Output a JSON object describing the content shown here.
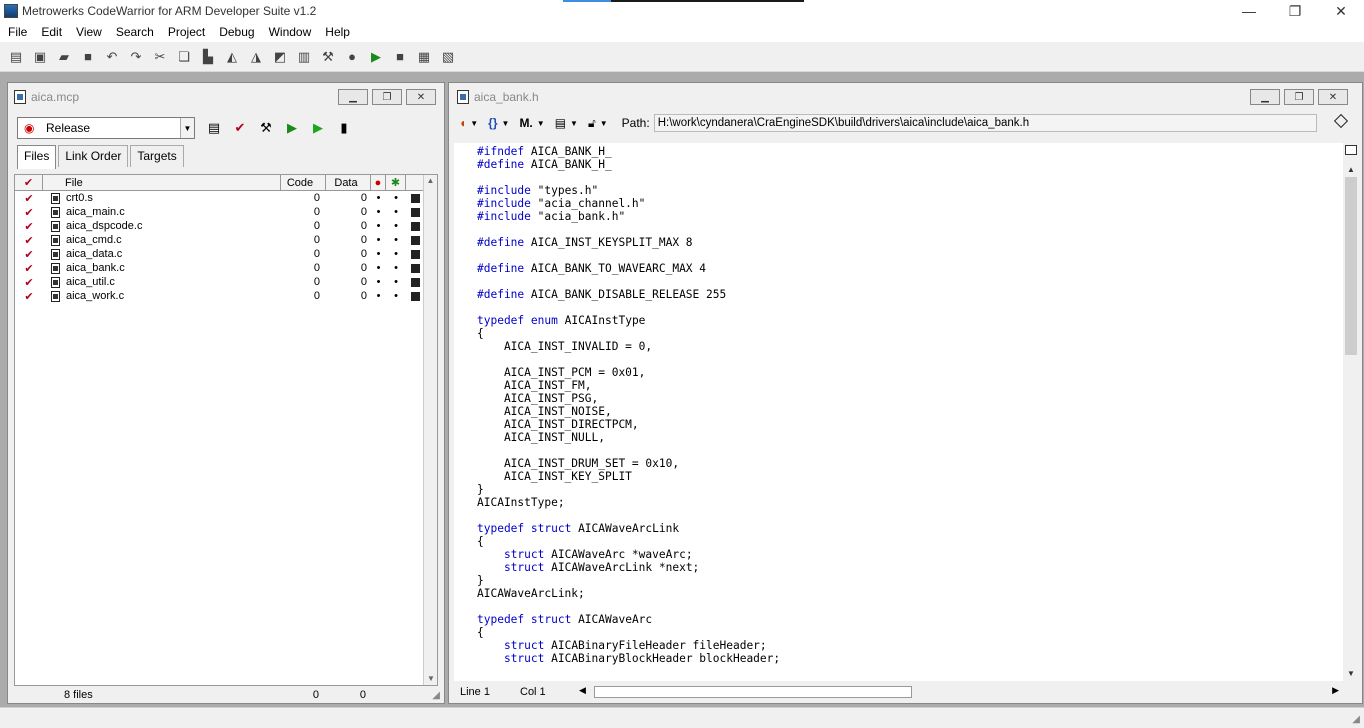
{
  "window": {
    "title": "Metrowerks CodeWarrior for ARM Developer Suite v1.2"
  },
  "menu": [
    "File",
    "Edit",
    "View",
    "Search",
    "Project",
    "Debug",
    "Window",
    "Help"
  ],
  "project": {
    "title": "aica.mcp",
    "target": "Release",
    "tabs": [
      "Files",
      "Link Order",
      "Targets"
    ],
    "columns": {
      "file": "File",
      "code": "Code",
      "data": "Data"
    },
    "files": [
      {
        "name": "crt0.s",
        "code": "0",
        "data": "0"
      },
      {
        "name": "aica_main.c",
        "code": "0",
        "data": "0"
      },
      {
        "name": "aica_dspcode.c",
        "code": "0",
        "data": "0"
      },
      {
        "name": "aica_cmd.c",
        "code": "0",
        "data": "0"
      },
      {
        "name": "aica_data.c",
        "code": "0",
        "data": "0"
      },
      {
        "name": "aica_bank.c",
        "code": "0",
        "data": "0"
      },
      {
        "name": "aica_util.c",
        "code": "0",
        "data": "0"
      },
      {
        "name": "aica_work.c",
        "code": "0",
        "data": "0"
      }
    ],
    "footer": {
      "count": "8 files",
      "code": "0",
      "data": "0"
    }
  },
  "editor": {
    "title": "aica_bank.h",
    "path_label": "Path:",
    "path": "H:\\work\\cyndanera\\CraEngineSDK\\build\\drivers\\aica\\include\\aica_bank.h",
    "status": {
      "line": "Line 1",
      "col": "Col 1"
    },
    "code": [
      [
        [
          "kw",
          "#ifndef"
        ],
        [
          "t",
          " AICA_BANK_H_"
        ]
      ],
      [
        [
          "kw",
          "#define"
        ],
        [
          "t",
          " AICA_BANK_H_"
        ]
      ],
      [],
      [
        [
          "kw",
          "#include"
        ],
        [
          "t",
          " \"types.h\""
        ]
      ],
      [
        [
          "kw",
          "#include"
        ],
        [
          "t",
          " \"acia_channel.h\""
        ]
      ],
      [
        [
          "kw",
          "#include"
        ],
        [
          "t",
          " \"acia_bank.h\""
        ]
      ],
      [],
      [
        [
          "kw",
          "#define"
        ],
        [
          "t",
          " AICA_INST_KEYSPLIT_MAX 8"
        ]
      ],
      [],
      [
        [
          "kw",
          "#define"
        ],
        [
          "t",
          " AICA_BANK_TO_WAVEARC_MAX 4"
        ]
      ],
      [],
      [
        [
          "kw",
          "#define"
        ],
        [
          "t",
          " AICA_BANK_DISABLE_RELEASE 255"
        ]
      ],
      [],
      [
        [
          "kw",
          "typedef"
        ],
        [
          "t",
          " "
        ],
        [
          "kw",
          "enum"
        ],
        [
          "t",
          " AICAInstType"
        ]
      ],
      [
        [
          "t",
          "{"
        ]
      ],
      [
        [
          "t",
          "    AICA_INST_INVALID = 0,"
        ]
      ],
      [],
      [
        [
          "t",
          "    AICA_INST_PCM = 0x01,"
        ]
      ],
      [
        [
          "t",
          "    AICA_INST_FM,"
        ]
      ],
      [
        [
          "t",
          "    AICA_INST_PSG,"
        ]
      ],
      [
        [
          "t",
          "    AICA_INST_NOISE,"
        ]
      ],
      [
        [
          "t",
          "    AICA_INST_DIRECTPCM,"
        ]
      ],
      [
        [
          "t",
          "    AICA_INST_NULL,"
        ]
      ],
      [],
      [
        [
          "t",
          "    AICA_INST_DRUM_SET = 0x10,"
        ]
      ],
      [
        [
          "t",
          "    AICA_INST_KEY_SPLIT"
        ]
      ],
      [
        [
          "t",
          "}"
        ]
      ],
      [
        [
          "t",
          "AICAInstType;"
        ]
      ],
      [],
      [
        [
          "kw",
          "typedef"
        ],
        [
          "t",
          " "
        ],
        [
          "kw",
          "struct"
        ],
        [
          "t",
          " AICAWaveArcLink"
        ]
      ],
      [
        [
          "t",
          "{"
        ]
      ],
      [
        [
          "t",
          "    "
        ],
        [
          "kw",
          "struct"
        ],
        [
          "t",
          " AICAWaveArc *waveArc;"
        ]
      ],
      [
        [
          "t",
          "    "
        ],
        [
          "kw",
          "struct"
        ],
        [
          "t",
          " AICAWaveArcLink *next;"
        ]
      ],
      [
        [
          "t",
          "}"
        ]
      ],
      [
        [
          "t",
          "AICAWaveArcLink;"
        ]
      ],
      [],
      [
        [
          "kw",
          "typedef"
        ],
        [
          "t",
          " "
        ],
        [
          "kw",
          "struct"
        ],
        [
          "t",
          " AICAWaveArc"
        ]
      ],
      [
        [
          "t",
          "{"
        ]
      ],
      [
        [
          "t",
          "    "
        ],
        [
          "kw",
          "struct"
        ],
        [
          "t",
          " AICABinaryFileHeader fileHeader;"
        ]
      ],
      [
        [
          "t",
          "    "
        ],
        [
          "kw",
          "struct"
        ],
        [
          "t",
          " AICABinaryBlockHeader blockHeader;"
        ]
      ]
    ]
  },
  "icons": {
    "toolbar": [
      "new-project-icon",
      "new-file-icon",
      "open-icon",
      "save-icon",
      "undo-icon",
      "redo-icon",
      "cut-icon",
      "copy-icon",
      "paste-icon",
      "find-icon",
      "find-next-icon",
      "replace-icon",
      "compare-icon",
      "make-icon",
      "stop-icon",
      "debug-icon",
      "run-icon",
      "sync-icon",
      "project-settings-icon",
      "target-settings-icon"
    ]
  },
  "colors": {
    "keyword": "#0000c8",
    "check": "#b2001e"
  }
}
